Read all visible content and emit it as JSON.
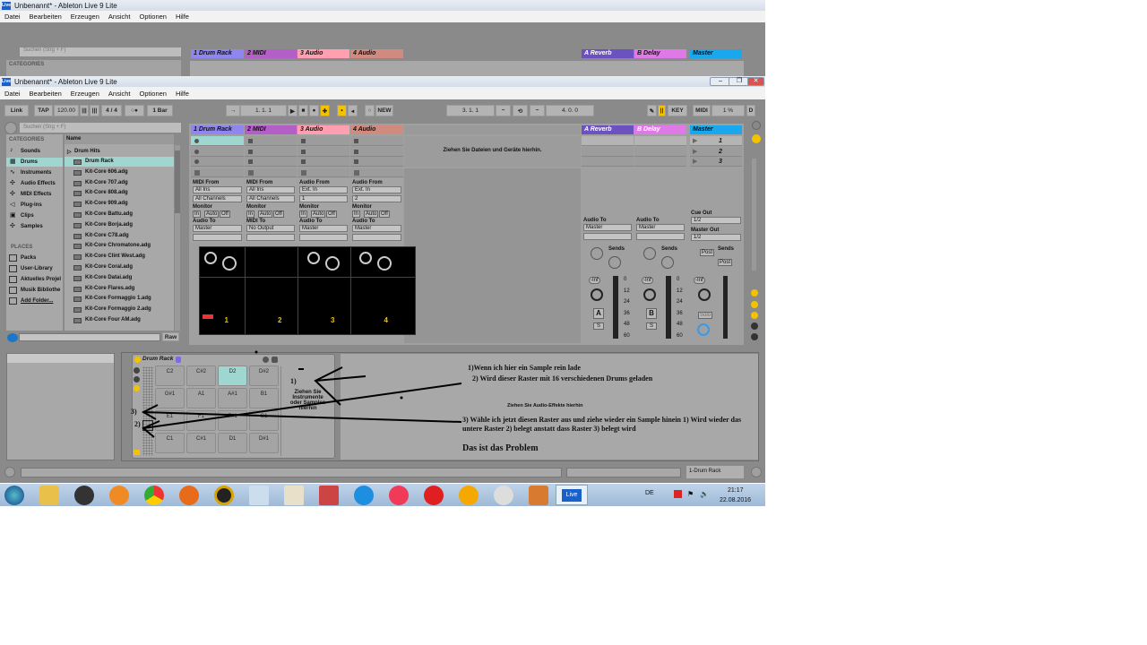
{
  "window": {
    "title": "Unbenannt* - Ableton Live 9 Lite",
    "logo": "Live"
  },
  "menu": [
    "Datei",
    "Bearbeiten",
    "Erzeugen",
    "Ansicht",
    "Optionen",
    "Hilfe"
  ],
  "toolbar": {
    "link": "Link",
    "tap": "TAP",
    "tempo": "120.00",
    "sig": "4 / 4",
    "metro": "○●",
    "quant": "1 Bar",
    "position": "1.   1.   1",
    "new": "NEW",
    "loop_start": "3.   1.   1",
    "loop_len": "4.   0.   0",
    "key": "KEY",
    "midi": "MIDI",
    "cpu": "1 %",
    "d": "D"
  },
  "browser": {
    "search_placeholder": "Suchen (Strg + F)",
    "categories_title": "CATEGORIES",
    "categories": [
      "Sounds",
      "Drums",
      "Instruments",
      "Audio Effects",
      "MIDI Effects",
      "Plug-ins",
      "Clips",
      "Samples"
    ],
    "places_title": "PLACES",
    "places": [
      "Packs",
      "User-Library",
      "Aktuelles Projel",
      "Musik Bibliothe",
      "Add Folder..."
    ],
    "name_header": "Name",
    "folder": "Drum Hits",
    "items": [
      "Drum Rack",
      "Kit-Core 606.adg",
      "Kit-Core 707.adg",
      "Kit-Core 808.adg",
      "Kit-Core 909.adg",
      "Kit-Core Battu.adg",
      "Kit-Core Borja.adg",
      "Kit-Core C78.adg",
      "Kit-Core Chromatone.adg",
      "Kit-Core Clint West.adg",
      "Kit-Core Coral.adg",
      "Kit-Core Datai.adg",
      "Kit-Core Flares.adg",
      "Kit-Core Formaggio 1.adg",
      "Kit-Core Formaggio 2.adg",
      "Kit-Core Four AM.adg"
    ],
    "raw": "Raw"
  },
  "tracks": [
    {
      "name": "1 Drum Rack",
      "color": "#8f86f0",
      "in_label": "MIDI From",
      "in": "All Ins",
      "ch": "All Channels",
      "out_label": "Audio To",
      "out": "Master",
      "num": "1"
    },
    {
      "name": "2 MIDI",
      "color": "#b45fc8",
      "in_label": "MIDI From",
      "in": "All Ins",
      "ch": "All Channels",
      "out_label": "MIDI To",
      "out": "No Output",
      "num": "2"
    },
    {
      "name": "3 Audio",
      "color": "#ff9fb0",
      "in_label": "Audio From",
      "in": "Ext. In",
      "ch": "1",
      "out_label": "Audio To",
      "out": "Master",
      "num": "3"
    },
    {
      "name": "4 Audio",
      "color": "#d08b7e",
      "in_label": "Audio From",
      "in": "Ext. In",
      "ch": "2",
      "out_label": "Audio To",
      "out": "Master",
      "num": "4"
    }
  ],
  "monitor": {
    "label": "Monitor",
    "in": "In",
    "auto": "Auto",
    "off": "Off"
  },
  "drop_hint": "Ziehen Sie Dateien und Geräte hierhin.",
  "returns": [
    {
      "name": "A Reverb",
      "color": "#6c52c0",
      "btn": "A"
    },
    {
      "name": "B Delay",
      "color": "#e079e8",
      "btn": "B"
    }
  ],
  "master": {
    "name": "Master",
    "color": "#19a8ee",
    "scenes": [
      "1",
      "2",
      "3"
    ],
    "cue_label": "Cue Out",
    "cue": "1/2",
    "out_label": "Master Out",
    "out": "1/2",
    "post": "Post",
    "solo": "Solo"
  },
  "mixer": {
    "audio_to": "Audio To",
    "master": "Master",
    "sends": "Sends",
    "inf": "-Inf",
    "s": "S",
    "scale": [
      "0",
      "12",
      "24",
      "36",
      "48",
      "60"
    ]
  },
  "drum_rack": {
    "title": "Drum Rack",
    "pads": [
      "C2",
      "C#2",
      "D2",
      "D#2",
      "G#1",
      "A1",
      "A#1",
      "B1",
      "E1",
      "F1",
      "F#1",
      "G1",
      "C1",
      "C#1",
      "D1",
      "D#1"
    ],
    "drop": "Ziehen Sie Instrumente oder Samples hierhin"
  },
  "fx_hint": "Ziehen Sie Audio-Effekte hierhin",
  "annotations": {
    "a1": "1)Wenn ich hier ein Sample rein lade",
    "a2": "2) Wird dieser Raster mit 16 verschiedenen Drums geladen",
    "a3": "3) Wähle ich jetzt diesen Raster aus  und ziehe wieder ein Sample hinein 1) Wird wieder das untere Raster 2) belegt anstatt dass Raster 3) belegt wird",
    "problem": "Das ist das Problem",
    "m1": "1)",
    "m2": "2)",
    "m3": "3)"
  },
  "status": {
    "track": "1-Drum Rack"
  },
  "taskbar": {
    "lang": "DE",
    "time": "21:17",
    "date": "22.08.2016",
    "live": "Live"
  }
}
